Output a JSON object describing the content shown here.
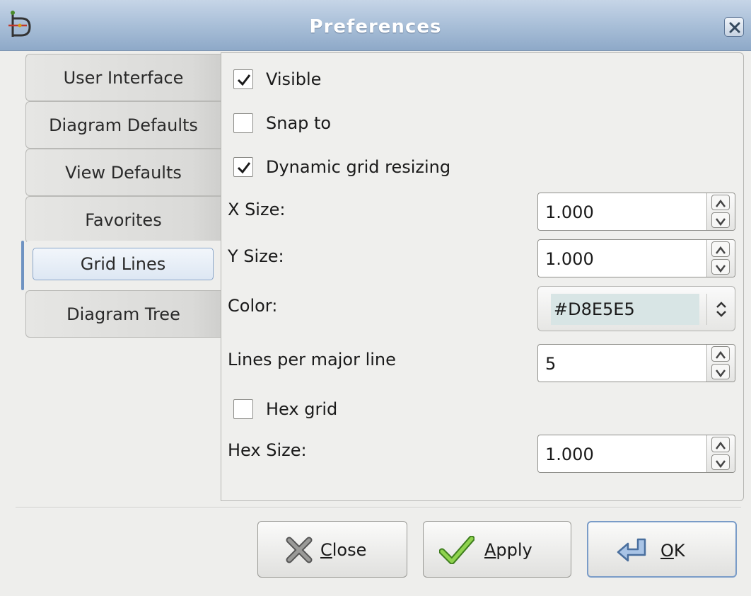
{
  "window": {
    "title": "Preferences"
  },
  "tabs": [
    {
      "label": "User Interface"
    },
    {
      "label": "Diagram Defaults"
    },
    {
      "label": "View Defaults"
    },
    {
      "label": "Favorites"
    },
    {
      "label": "Grid Lines",
      "active": true
    },
    {
      "label": "Diagram Tree"
    }
  ],
  "grid": {
    "visible": {
      "label": "Visible",
      "checked": true
    },
    "snap_to": {
      "label": "Snap to",
      "checked": false
    },
    "dynamic": {
      "label": "Dynamic grid resizing",
      "checked": true
    },
    "x_size": {
      "label": "X Size:",
      "value": "1.000"
    },
    "y_size": {
      "label": "Y Size:",
      "value": "1.000"
    },
    "color": {
      "label": "Color:",
      "value": "#D8E5E5"
    },
    "lines_per_major": {
      "label": "Lines per major line",
      "value": "5"
    },
    "hex_grid": {
      "label": "Hex grid",
      "checked": false
    },
    "hex_size": {
      "label": "Hex Size:",
      "value": "1.000"
    }
  },
  "buttons": {
    "close": {
      "mnemonic": "C",
      "rest": "lose"
    },
    "apply": {
      "mnemonic": "A",
      "rest": "pply"
    },
    "ok": {
      "mnemonic": "O",
      "rest": "K"
    }
  },
  "colors": {
    "titlebar": "#a9bfd8",
    "accent": "#7a9cc8",
    "grid_color_swatch": "#d8e5e5"
  }
}
